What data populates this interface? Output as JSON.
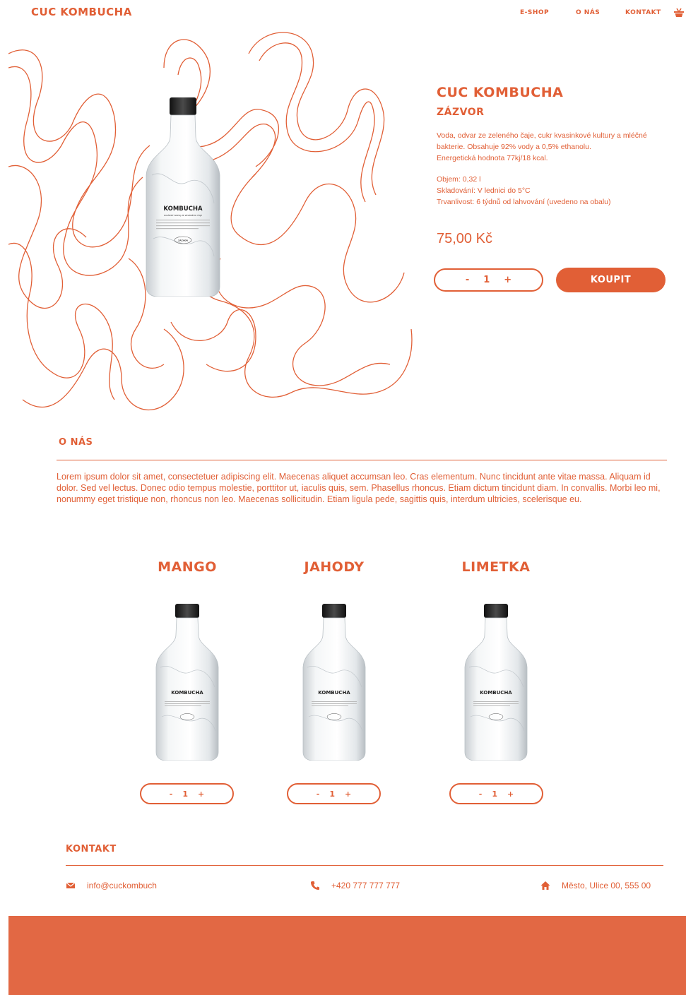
{
  "header": {
    "logo": "CUC KOMBUCHA",
    "nav": {
      "eshop": "E-SHOP",
      "onas": "O NÁS",
      "kontakt": "KONTAKT"
    }
  },
  "product": {
    "title": "CUC KOMBUCHA",
    "flavor": "ZÁZVOR",
    "description": [
      "Voda, odvar ze zeleného čaje, cukr kvasinkové kultury a mléčné",
      "bakterie. Obsahuje 92% vody a 0,5% ethanolu.",
      "Energetická hodnota 77kj/18 kcal."
    ],
    "info": [
      "Objem: 0,32 l",
      "Skladování: V lednici do 5°C",
      "Trvanlivost: 6 týdnů od lahvování (uvedeno na obalu)"
    ],
    "price": "75,00 Kč",
    "qty": {
      "minus": "-",
      "value": "1",
      "plus": "+"
    },
    "buy_label": "KOUPIT",
    "bottle_label": "KOMBUCHA",
    "bottle_sub": "KVAŠENÝ NÁPOJ ZE ZELENÉHO ČAJE",
    "bottle_flavor": "ZÁZVOR"
  },
  "about": {
    "title": "O NÁS",
    "text": "Lorem ipsum dolor sit amet, consectetuer adipiscing elit. Maecenas aliquet accumsan leo. Cras elementum. Nunc tincidunt ante vitae massa. Aliquam id dolor. Sed vel lectus. Donec odio tempus molestie, porttitor ut, iaculis quis, sem. Phasellus rhoncus. Etiam dictum tincidunt diam. In convallis. Morbi leo mi, nonummy eget tristique non, rhoncus non leo. Maecenas sollicitudin. Etiam ligula pede, sagittis quis, interdum ultricies, scelerisque eu."
  },
  "cards": [
    {
      "title": "MANGO",
      "qty": {
        "minus": "-",
        "value": "1",
        "plus": "+"
      }
    },
    {
      "title": "JAHODY",
      "qty": {
        "minus": "-",
        "value": "1",
        "plus": "+"
      }
    },
    {
      "title": "LIMETKA",
      "qty": {
        "minus": "-",
        "value": "1",
        "plus": "+"
      }
    }
  ],
  "contact": {
    "title": "KONTAKT",
    "email": "info@cuckombuch",
    "phone": "+420 777 777 777",
    "address": "Město, Ulice 00, 555 00",
    "icons": {
      "email": "envelope-icon",
      "phone": "phone-icon",
      "address": "home-icon"
    }
  },
  "colors": {
    "accent": "#e15f36",
    "footer": "#e26844"
  }
}
